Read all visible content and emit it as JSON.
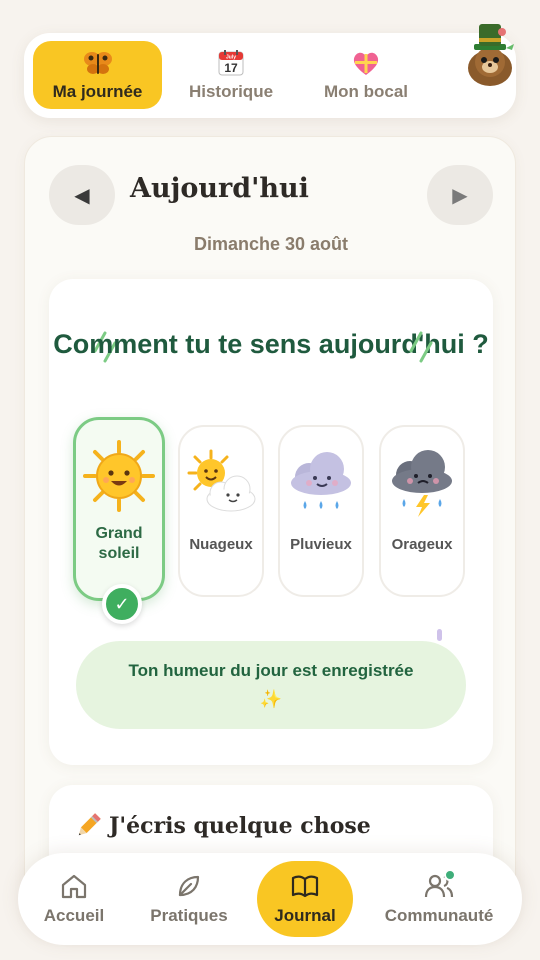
{
  "top_tabs": [
    {
      "label": "Ma journée",
      "icon": "butterfly-icon",
      "active": true
    },
    {
      "label": "Historique",
      "icon": "calendar-icon",
      "calendar_month": "July",
      "calendar_day": "17",
      "active": false
    },
    {
      "label": "Mon bocal",
      "icon": "heart-gift-icon",
      "active": false
    }
  ],
  "day": {
    "title": "Aujourd'hui",
    "date": "Dimanche 30 août",
    "prev_symbol": "◀",
    "next_symbol": "▶"
  },
  "mood": {
    "question": "Comment tu te sens aujourd'hui ?",
    "options": [
      {
        "label": "Grand soleil",
        "icon": "sun-icon",
        "selected": true
      },
      {
        "label": "Nuageux",
        "icon": "sun-cloud-icon",
        "selected": false
      },
      {
        "label": "Pluvieux",
        "icon": "rain-cloud-icon",
        "selected": false
      },
      {
        "label": "Orageux",
        "icon": "storm-cloud-icon",
        "selected": false
      }
    ],
    "check_symbol": "✓",
    "saved_message": "Ton humeur du jour est enregistrée",
    "saved_sparkle": "✨"
  },
  "write": {
    "title": "J'écris quelque chose"
  },
  "bottom_nav": [
    {
      "label": "Accueil",
      "icon": "home-icon",
      "active": false
    },
    {
      "label": "Pratiques",
      "icon": "leaf-icon",
      "active": false
    },
    {
      "label": "Journal",
      "icon": "book-icon",
      "active": true
    },
    {
      "label": "Communauté",
      "icon": "people-icon",
      "active": false,
      "notification": true
    }
  ],
  "colors": {
    "accent_yellow": "#f9c623",
    "primary_green": "#1f5a3e",
    "selected_border": "#7ccb84",
    "success_green": "#3fae5f",
    "background": "#f7f3ee"
  }
}
